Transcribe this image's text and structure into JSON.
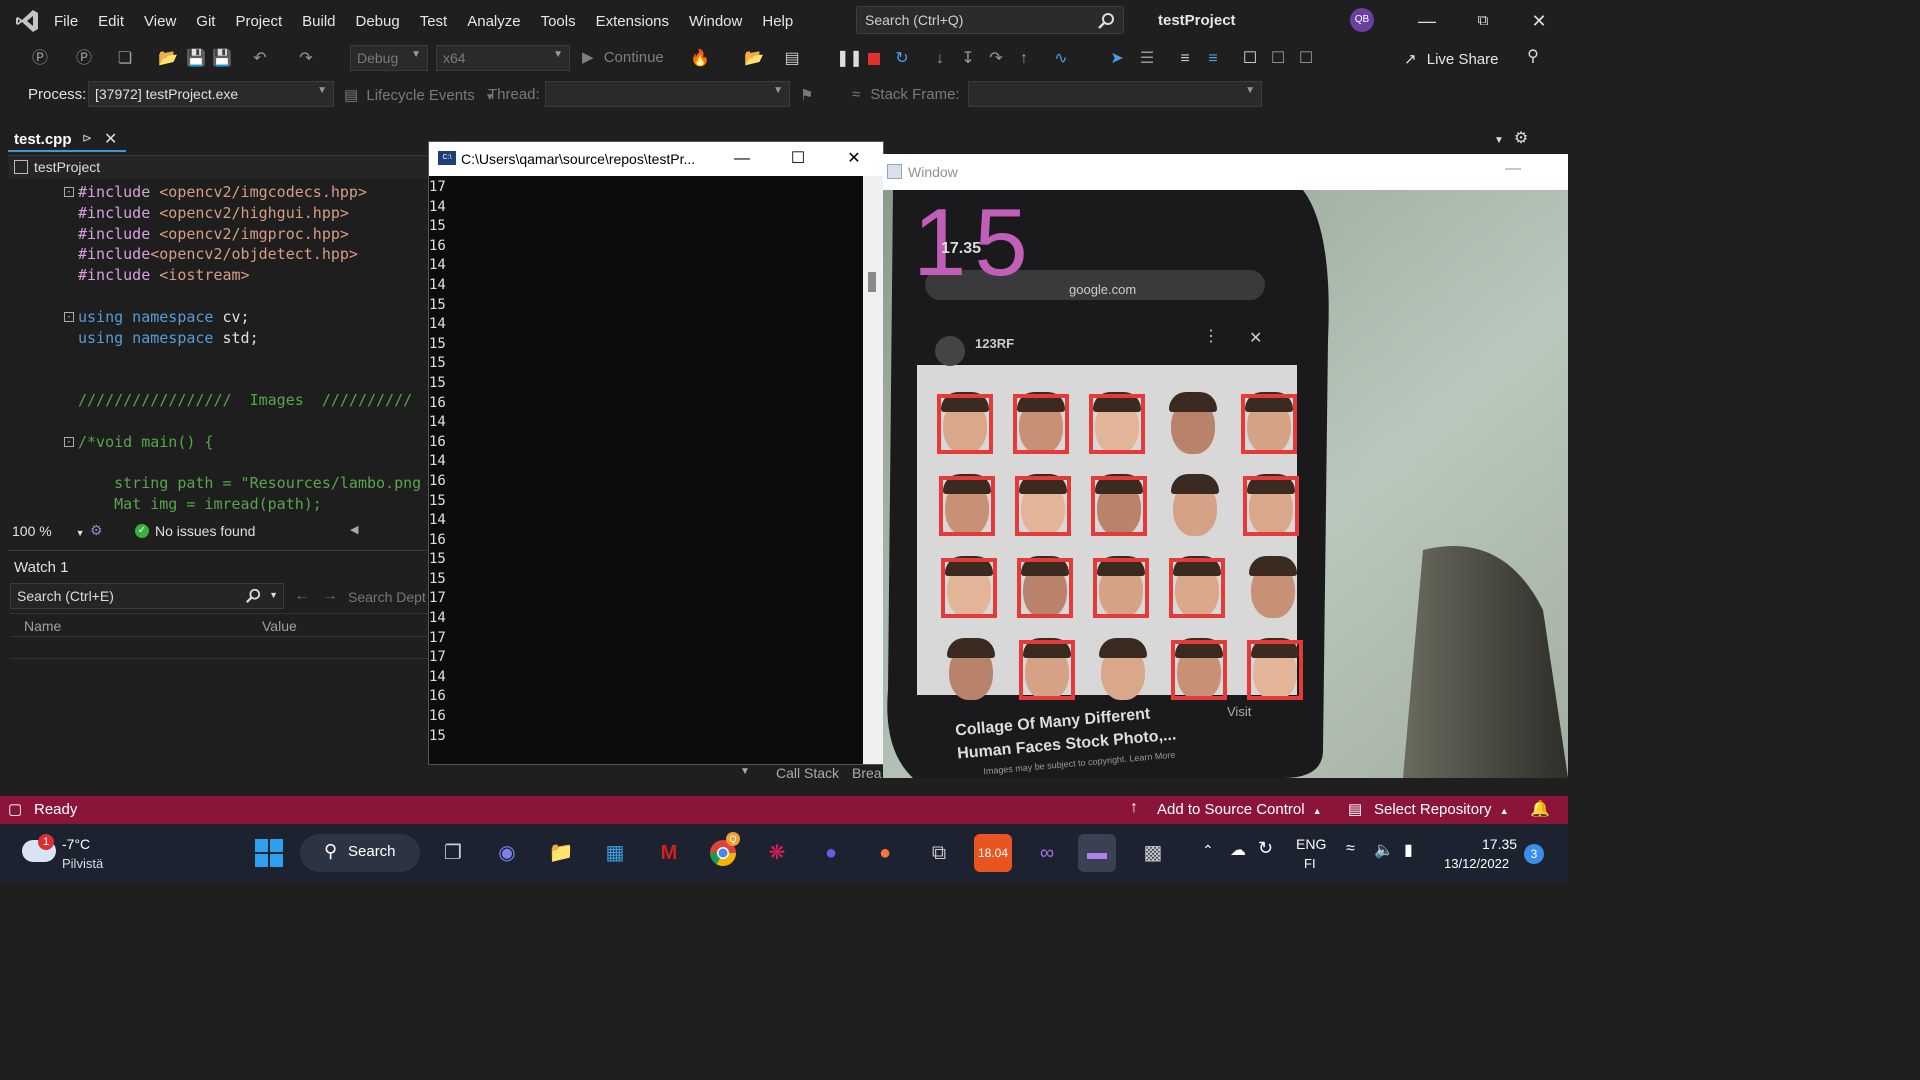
{
  "menubar": {
    "items": [
      "File",
      "Edit",
      "View",
      "Git",
      "Project",
      "Build",
      "Debug",
      "Test",
      "Analyze",
      "Tools",
      "Extensions",
      "Window",
      "Help"
    ],
    "search_placeholder": "Search (Ctrl+Q)",
    "project_title": "testProject",
    "avatar_initials": "QB"
  },
  "toolbar": {
    "config": "Debug",
    "platform": "x64",
    "continue_label": "Continue",
    "live_share": "Live Share",
    "process_label": "Process:",
    "process_value": "[37972] testProject.exe",
    "lifecycle_label": "Lifecycle Events",
    "thread_label": "Thread:",
    "stack_frame_label": "Stack Frame:"
  },
  "editor": {
    "tab_label": "test.cpp",
    "nav_project": "testProject",
    "zoom": "100 %",
    "issues": "No issues found",
    "lines": [
      {
        "fold": true,
        "parts": [
          [
            "inc",
            "#include "
          ],
          [
            "ang",
            "<opencv2/imgcodecs.hpp>"
          ]
        ]
      },
      {
        "fold": false,
        "parts": [
          [
            "inc",
            "#include "
          ],
          [
            "ang",
            "<opencv2/highgui.hpp>"
          ]
        ]
      },
      {
        "fold": false,
        "parts": [
          [
            "inc",
            "#include "
          ],
          [
            "ang",
            "<opencv2/imgproc.hpp>"
          ]
        ]
      },
      {
        "fold": false,
        "parts": [
          [
            "inc",
            "#include"
          ],
          [
            "ang",
            "<opencv2/objdetect.hpp>"
          ]
        ]
      },
      {
        "fold": false,
        "parts": [
          [
            "inc",
            "#include "
          ],
          [
            "ang",
            "<iostream>"
          ]
        ]
      },
      {
        "fold": false,
        "parts": []
      },
      {
        "fold": true,
        "parts": [
          [
            "kw",
            "using namespace "
          ],
          [
            "plain",
            "cv;"
          ]
        ]
      },
      {
        "fold": false,
        "parts": [
          [
            "kw",
            "using namespace "
          ],
          [
            "plain",
            "std;"
          ]
        ]
      },
      {
        "fold": false,
        "parts": []
      },
      {
        "fold": false,
        "parts": []
      },
      {
        "fold": false,
        "parts": [
          [
            "cmt",
            "/////////////////  Images  //////////"
          ]
        ]
      },
      {
        "fold": false,
        "parts": []
      },
      {
        "fold": true,
        "parts": [
          [
            "cmt",
            "/*void main() {"
          ]
        ]
      },
      {
        "fold": false,
        "parts": []
      },
      {
        "fold": false,
        "parts": [
          [
            "cmt",
            "    string path = \"Resources/lambo.png"
          ]
        ]
      },
      {
        "fold": false,
        "parts": [
          [
            "cmt",
            "    Mat img = imread(path);"
          ]
        ]
      }
    ]
  },
  "watch": {
    "title": "Watch 1",
    "search_placeholder": "Search (Ctrl+E)",
    "search_depth": "Search Dept",
    "col_name": "Name",
    "col_value": "Value",
    "call_stack": "Call Stack",
    "breakpoints": "Brea"
  },
  "console": {
    "title": "C:\\Users\\qamar\\source\\repos\\testPr...",
    "output": [
      "17",
      "14",
      "15",
      "16",
      "14",
      "14",
      "15",
      "14",
      "15",
      "15",
      "15",
      "16",
      "14",
      "16",
      "14",
      "16",
      "15",
      "14",
      "16",
      "15",
      "15",
      "17",
      "14",
      "17",
      "17",
      "14",
      "16",
      "16",
      "15"
    ]
  },
  "camera_window": {
    "title": "Window",
    "face_count": "15",
    "phone_time": "17.35",
    "phone_url": "google.com",
    "site_name": "123RF",
    "caption_line1": "Collage Of Many Different",
    "caption_line2": "Human Faces Stock Photo,...",
    "visit": "Visit",
    "small_print": "Images may be subject to copyright.  Learn More"
  },
  "statusbar": {
    "ready": "Ready",
    "add_source": "Add to Source Control",
    "select_repo": "Select Repository"
  },
  "taskbar": {
    "weather_temp": "-7°C",
    "weather_desc": "Pilvistä",
    "weather_badge": "1",
    "search": "Search",
    "lang1": "ENG",
    "lang2": "FI",
    "time": "17.35",
    "date": "13/12/2022",
    "notifications": "3",
    "chrome_badge": "Q"
  },
  "colors": {
    "accent": "#8a1538",
    "taskbar": "#1c2230",
    "face_box": "#e43a3a",
    "count_text": "#c05eb8"
  }
}
